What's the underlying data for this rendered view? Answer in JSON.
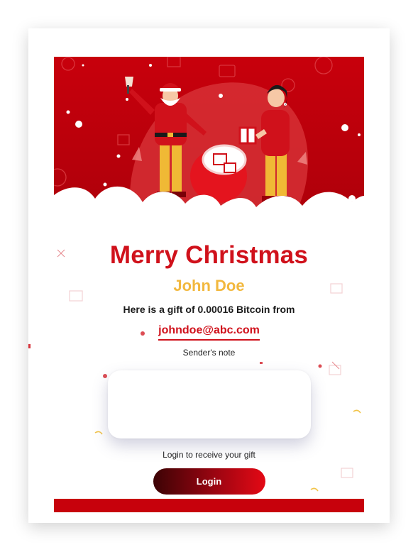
{
  "card": {
    "title": "Merry Christmas",
    "recipient_name": "John Doe",
    "gift_message": "Here is a gift of 0.00016 Bitcoin from",
    "sender_email": "johndoe@abc.com",
    "note_label": "Sender's note",
    "note_text": "",
    "login_hint": "Login to receive your gift",
    "login_label": "Login"
  },
  "colors": {
    "brand_red": "#d0111b",
    "frame_red": "#c7010c",
    "dark_red": "#3c0305",
    "name_gold": "#f2b83e",
    "background": "#ffffff"
  },
  "icons": [
    "santa-illustration",
    "woman-with-gift-illustration",
    "gift-sack-icon",
    "bell-icon",
    "bitcoin-coin-icon",
    "gift-box-icon",
    "confetti-icon",
    "snowflake-icon",
    "close-x-icon"
  ]
}
